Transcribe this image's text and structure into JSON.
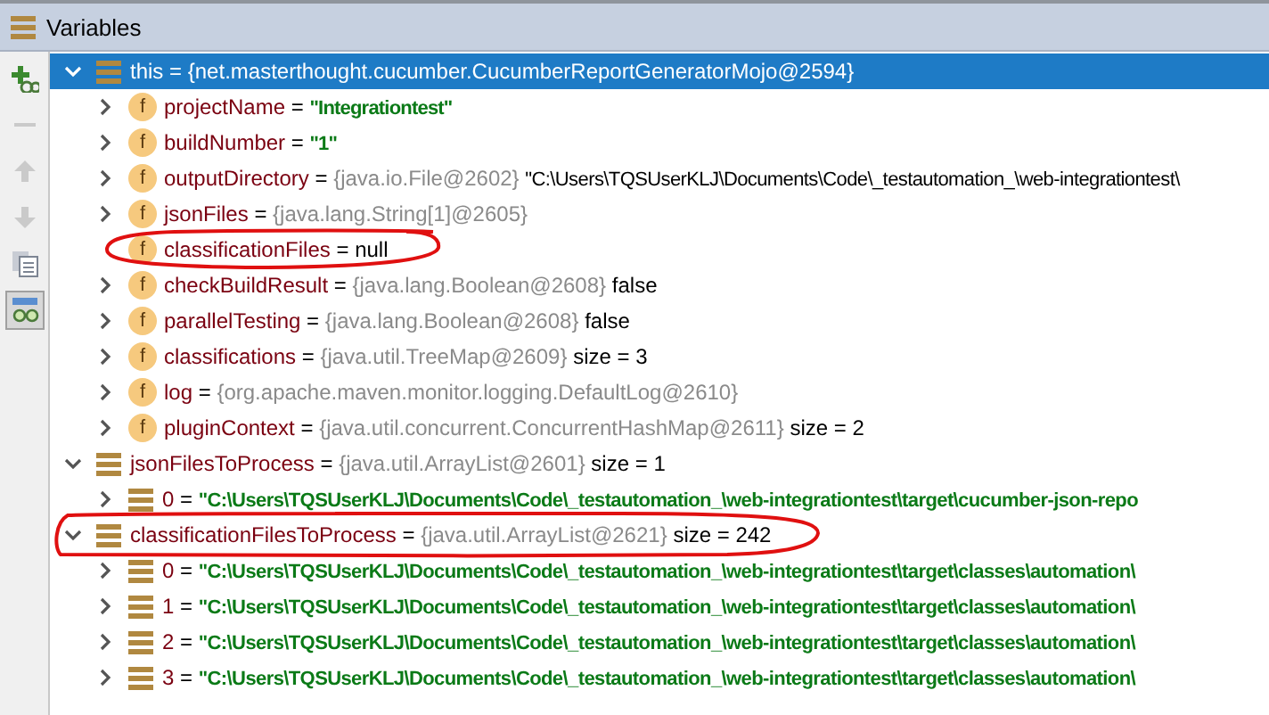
{
  "panel": {
    "title": "Variables"
  },
  "toolbar": [
    {
      "kind": "add-watch",
      "disabled": false,
      "pressed": false
    },
    {
      "kind": "remove",
      "disabled": true,
      "pressed": false
    },
    {
      "kind": "up",
      "disabled": true,
      "pressed": false
    },
    {
      "kind": "down",
      "disabled": true,
      "pressed": false
    },
    {
      "kind": "copy",
      "disabled": false,
      "pressed": false
    },
    {
      "kind": "watches",
      "disabled": false,
      "pressed": true
    }
  ],
  "tree": {
    "rows": [
      {
        "kind": "object",
        "expanded": true,
        "selected": true,
        "name": "this",
        "sign": "=",
        "type": "{net.masterthought.cucumber.CucumberReportGeneratorMojo@2594}",
        "children": [
          {
            "kind": "field",
            "expanded": false,
            "letter": "f",
            "selected": false,
            "name": "projectName",
            "sign": "=",
            "value": {
              "kind": "string",
              "text": "\"Integrationtest\""
            }
          },
          {
            "kind": "field",
            "expanded": false,
            "letter": "f",
            "selected": false,
            "name": "buildNumber",
            "sign": "=",
            "value": {
              "kind": "string",
              "text": "\"1\""
            }
          },
          {
            "kind": "field",
            "expanded": false,
            "letter": "f",
            "selected": false,
            "name": "outputDirectory",
            "sign": "=",
            "type": "{java.io.File@2602}",
            "value": {
              "kind": "plain",
              "text": "\"C:\\Users\\TQSUserKLJ\\Documents\\Code\\_testautomation_\\web-integrationtest\\"
            }
          },
          {
            "kind": "field",
            "expanded": false,
            "letter": "f",
            "selected": false,
            "name": "jsonFiles",
            "sign": "=",
            "type": "{java.lang.String[1]@2605}"
          },
          {
            "kind": "leaf-field",
            "letter": "f",
            "selected": false,
            "name": "classificationFiles",
            "sign": "=",
            "value": {
              "kind": "plain",
              "text": "null"
            }
          },
          {
            "kind": "field",
            "expanded": false,
            "letter": "f",
            "selected": false,
            "name": "checkBuildResult",
            "sign": "=",
            "type": "{java.lang.Boolean@2608}",
            "value": {
              "kind": "plain",
              "text": "false"
            }
          },
          {
            "kind": "field",
            "expanded": false,
            "letter": "f",
            "selected": false,
            "name": "parallelTesting",
            "sign": "=",
            "type": "{java.lang.Boolean@2608}",
            "value": {
              "kind": "plain",
              "text": "false"
            }
          },
          {
            "kind": "field",
            "expanded": false,
            "letter": "f",
            "selected": false,
            "name": "classifications",
            "sign": "=",
            "type": "{java.util.TreeMap@2609}",
            "value": {
              "kind": "plain",
              "text": "size = 3"
            }
          },
          {
            "kind": "field",
            "expanded": false,
            "letter": "f",
            "selected": false,
            "name": "log",
            "sign": "=",
            "type": "{org.apache.maven.monitor.logging.DefaultLog@2610}"
          },
          {
            "kind": "field",
            "expanded": false,
            "letter": "f",
            "selected": false,
            "name": "pluginContext",
            "sign": "=",
            "type": "{java.util.concurrent.ConcurrentHashMap@2611}",
            "value": {
              "kind": "plain",
              "text": "size = 2"
            }
          }
        ]
      },
      {
        "kind": "object",
        "expanded": true,
        "selected": false,
        "name": "jsonFilesToProcess",
        "sign": "=",
        "type": "{java.util.ArrayList@2601}",
        "value": {
          "kind": "plain",
          "text": "size = 1"
        },
        "children": [
          {
            "kind": "object",
            "expanded": false,
            "selected": false,
            "name": "0",
            "sign": "=",
            "value": {
              "kind": "string",
              "text": "\"C:\\Users\\TQSUserKLJ\\Documents\\Code\\_testautomation_\\web-integrationtest\\target\\cucumber-json-repo"
            }
          }
        ]
      },
      {
        "kind": "object",
        "expanded": true,
        "selected": false,
        "name": "classificationFilesToProcess",
        "sign": "=",
        "type": "{java.util.ArrayList@2621}",
        "value": {
          "kind": "plain",
          "text": "size = 242"
        },
        "children": [
          {
            "kind": "object",
            "expanded": false,
            "selected": false,
            "name": "0",
            "sign": "=",
            "value": {
              "kind": "string",
              "text": "\"C:\\Users\\TQSUserKLJ\\Documents\\Code\\_testautomation_\\web-integrationtest\\target\\classes\\automation\\"
            }
          },
          {
            "kind": "object",
            "expanded": false,
            "selected": false,
            "name": "1",
            "sign": "=",
            "value": {
              "kind": "string",
              "text": "\"C:\\Users\\TQSUserKLJ\\Documents\\Code\\_testautomation_\\web-integrationtest\\target\\classes\\automation\\"
            }
          },
          {
            "kind": "object",
            "expanded": false,
            "selected": false,
            "name": "2",
            "sign": "=",
            "value": {
              "kind": "string",
              "text": "\"C:\\Users\\TQSUserKLJ\\Documents\\Code\\_testautomation_\\web-integrationtest\\target\\classes\\automation\\"
            }
          },
          {
            "kind": "object",
            "expanded": false,
            "selected": false,
            "name": "3",
            "sign": "=",
            "value": {
              "kind": "string",
              "text": "\"C:\\Users\\TQSUserKLJ\\Documents\\Code\\_testautomation_\\web-integrationtest\\target\\classes\\automation\\"
            }
          }
        ]
      }
    ]
  }
}
